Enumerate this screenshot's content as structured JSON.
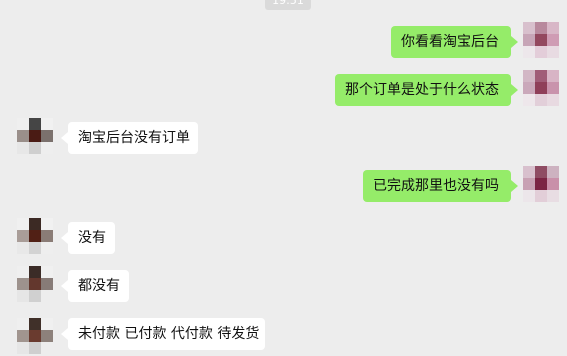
{
  "chat": {
    "timestamp": "19:51",
    "messages": [
      {
        "side": "right",
        "text": "你看看淘宝后台"
      },
      {
        "side": "right",
        "text": "那个订单是处于什么状态"
      },
      {
        "side": "left",
        "text": "淘宝后台没有订单"
      },
      {
        "side": "right",
        "text": "已完成那里也没有吗"
      },
      {
        "side": "left",
        "text": "没有"
      },
      {
        "side": "left",
        "text": "都没有"
      },
      {
        "side": "left",
        "text": "未付款 已付款 代付款 待发货"
      }
    ]
  },
  "colors": {
    "background": "#ededed",
    "outgoing_bubble": "#95ec69",
    "incoming_bubble": "#ffffff"
  },
  "icons": {
    "my_avatar": "avatar-icon",
    "contact_avatar": "avatar-icon"
  }
}
